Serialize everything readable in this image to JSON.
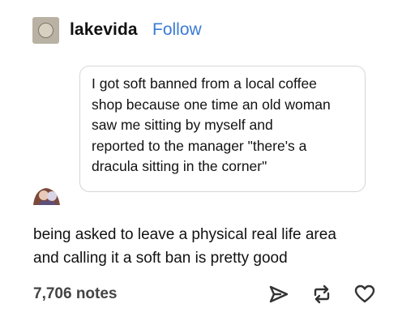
{
  "post": {
    "author": "lakevida",
    "follow_label": "Follow",
    "ask_text": "I got soft banned from a local coffee\nshop because one time an old woman\nsaw me sitting by myself and\nreported to the manager \"there's a\ndracula sitting in the corner\"",
    "response_text": "being asked to leave a physical real life area\nand calling it a soft ban is pretty good",
    "notes_count": "7,706 notes"
  },
  "colors": {
    "follow": "#3a7bd5",
    "border": "#d6d6d6",
    "icon": "#333333"
  },
  "icons": [
    "share-icon",
    "reblog-icon",
    "like-heart-icon"
  ]
}
